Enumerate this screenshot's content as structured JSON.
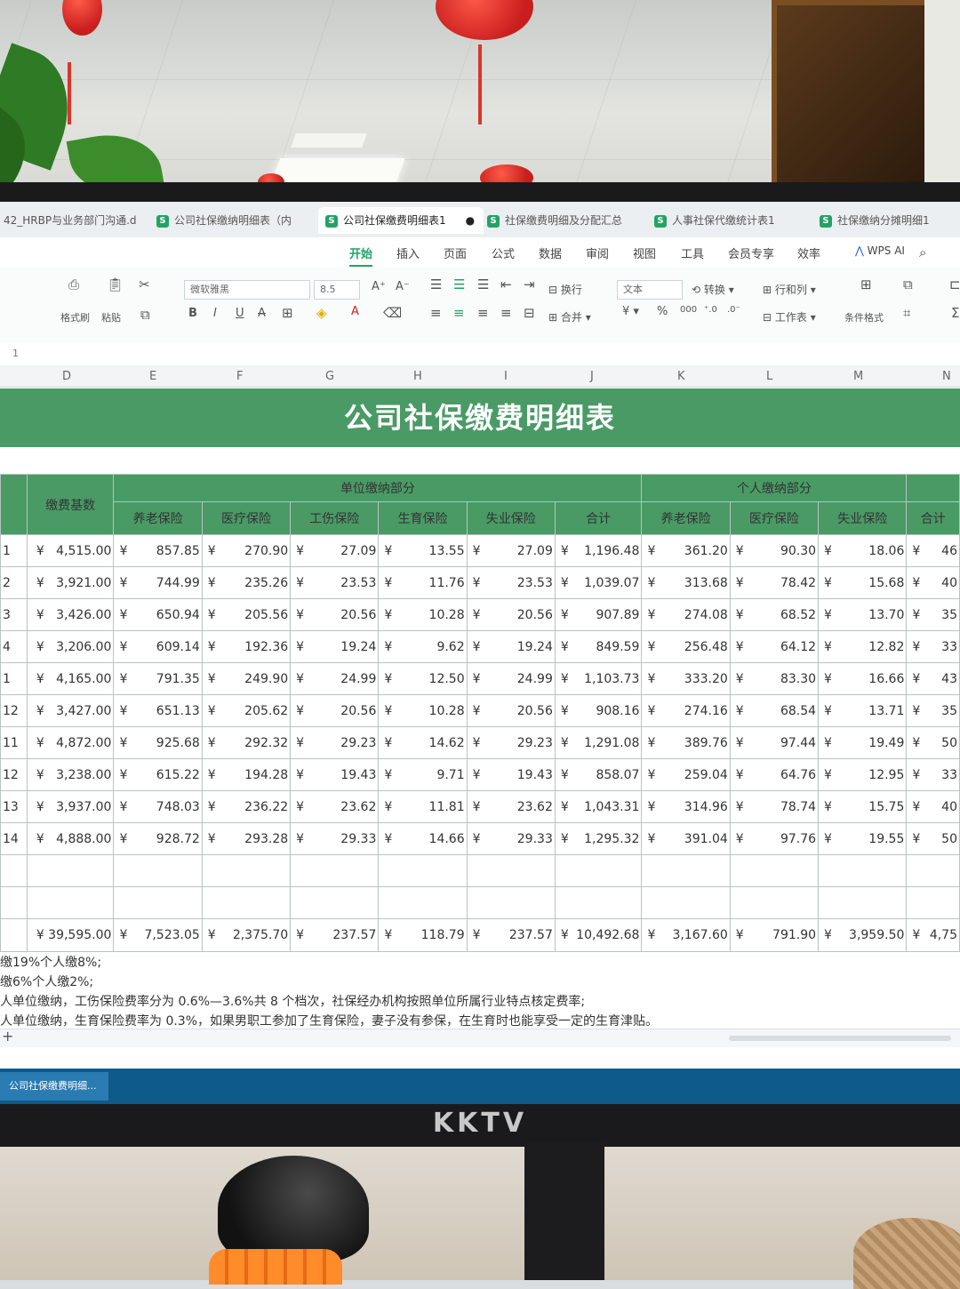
{
  "tabs": [
    {
      "label": "42_HRBP与业务部门沟通.d"
    },
    {
      "label": "公司社保缴纳明细表（内"
    },
    {
      "label": "公司社保缴费明细表1"
    },
    {
      "label": "社保缴费明细及分配汇总"
    },
    {
      "label": "人事社保代缴统计表1"
    },
    {
      "label": "社保缴纳分摊明细1"
    }
  ],
  "ribbon_tabs": [
    "开始",
    "插入",
    "页面",
    "公式",
    "数据",
    "审阅",
    "视图",
    "工具",
    "会员专享",
    "效率"
  ],
  "wps_ai": "WPS AI",
  "ribbon": {
    "format_painter": "格式刷",
    "paste": "粘贴",
    "font_name": "微软雅黑",
    "font_size": "8.5",
    "wrap": "换行",
    "merge": "合并",
    "number_format": "文本",
    "convert": "转换",
    "row_col": "行和列",
    "worksheet": "工作表",
    "conditional_format": "条件格式"
  },
  "formula_bar": {
    "value": "1"
  },
  "columns": [
    "D",
    "E",
    "F",
    "G",
    "H",
    "I",
    "J",
    "K",
    "L",
    "M",
    "N"
  ],
  "sheet": {
    "title": "公司社保缴费明细表",
    "group_company": "单位缴纳部分",
    "group_personal": "个人缴纳部分",
    "base_header": "缴费基数",
    "headers_company": [
      "养老保险",
      "医疗保险",
      "工伤保险",
      "生育保险",
      "失业保险",
      "合计"
    ],
    "headers_personal": [
      "养老保险",
      "医疗保险",
      "失业保险",
      "合计"
    ],
    "currency": "¥",
    "rows": [
      {
        "id": "1",
        "base": "4,515.00",
        "c": [
          "857.85",
          "270.90",
          "27.09",
          "13.55",
          "27.09",
          "1,196.48"
        ],
        "p": [
          "361.20",
          "90.30",
          "18.06",
          "46"
        ]
      },
      {
        "id": "2",
        "base": "3,921.00",
        "c": [
          "744.99",
          "235.26",
          "23.53",
          "11.76",
          "23.53",
          "1,039.07"
        ],
        "p": [
          "313.68",
          "78.42",
          "15.68",
          "40"
        ]
      },
      {
        "id": "3",
        "base": "3,426.00",
        "c": [
          "650.94",
          "205.56",
          "20.56",
          "10.28",
          "20.56",
          "907.89"
        ],
        "p": [
          "274.08",
          "68.52",
          "13.70",
          "35"
        ]
      },
      {
        "id": "4",
        "base": "3,206.00",
        "c": [
          "609.14",
          "192.36",
          "19.24",
          "9.62",
          "19.24",
          "849.59"
        ],
        "p": [
          "256.48",
          "64.12",
          "12.82",
          "33"
        ]
      },
      {
        "id": "1",
        "base": "4,165.00",
        "c": [
          "791.35",
          "249.90",
          "24.99",
          "12.50",
          "24.99",
          "1,103.73"
        ],
        "p": [
          "333.20",
          "83.30",
          "16.66",
          "43"
        ]
      },
      {
        "id": "12",
        "base": "3,427.00",
        "c": [
          "651.13",
          "205.62",
          "20.56",
          "10.28",
          "20.56",
          "908.16"
        ],
        "p": [
          "274.16",
          "68.54",
          "13.71",
          "35"
        ]
      },
      {
        "id": "11",
        "base": "4,872.00",
        "c": [
          "925.68",
          "292.32",
          "29.23",
          "14.62",
          "29.23",
          "1,291.08"
        ],
        "p": [
          "389.76",
          "97.44",
          "19.49",
          "50"
        ]
      },
      {
        "id": "12",
        "base": "3,238.00",
        "c": [
          "615.22",
          "194.28",
          "19.43",
          "9.71",
          "19.43",
          "858.07"
        ],
        "p": [
          "259.04",
          "64.76",
          "12.95",
          "33"
        ]
      },
      {
        "id": "13",
        "base": "3,937.00",
        "c": [
          "748.03",
          "236.22",
          "23.62",
          "11.81",
          "23.62",
          "1,043.31"
        ],
        "p": [
          "314.96",
          "78.74",
          "15.75",
          "40"
        ]
      },
      {
        "id": "14",
        "base": "4,888.00",
        "c": [
          "928.72",
          "293.28",
          "29.33",
          "14.66",
          "29.33",
          "1,295.32"
        ],
        "p": [
          "391.04",
          "97.76",
          "19.55",
          "50"
        ]
      }
    ],
    "total": {
      "base": "39,595.00",
      "c": [
        "7,523.05",
        "2,375.70",
        "237.57",
        "118.79",
        "237.57",
        "10,492.68"
      ],
      "p": [
        "3,167.60",
        "791.90",
        "3,959.50",
        "4,75"
      ]
    },
    "notes": [
      "缴19%个人缴8%;",
      "缴6%个人缴2%;",
      "人单位缴纳，工伤保险费率分为 0.6%—3.6%共 8 个档次，社保经办机构按照单位所属行业特点核定费率;",
      "人单位缴纳，生育保险费率为 0.3%，如果男职工参加了生育保险，妻子没有参保，在生育时也能享受一定的生育津贴。"
    ]
  },
  "taskbar": {
    "item": "公司社保缴费明细..."
  },
  "monitor_brand": "KKTV",
  "colors": {
    "header_green": "#4a9a66",
    "accent": "#21a366"
  }
}
